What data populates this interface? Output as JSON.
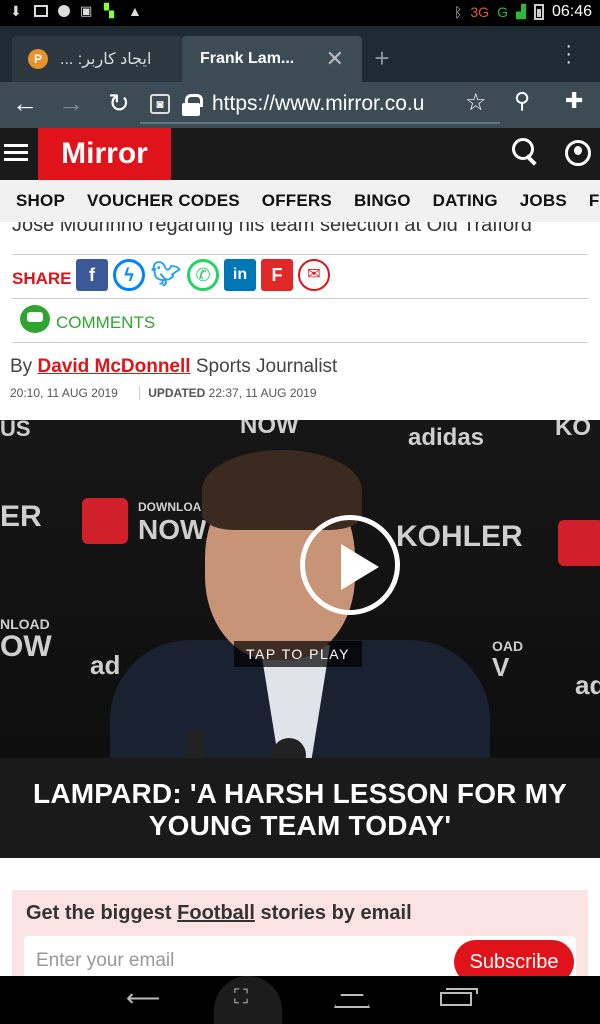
{
  "status_bar": {
    "network": "3G",
    "signal": "G",
    "time": "06:46"
  },
  "tabs": [
    {
      "title": "ایجاد کاربر: ...",
      "active": false
    },
    {
      "title": "Frank Lam...",
      "active": true
    }
  ],
  "address_bar": {
    "url": "https://www.mirror.co.u"
  },
  "site": {
    "logo": "Mirror",
    "brand_color": "#e0131a"
  },
  "nav": {
    "items": [
      "SHOP",
      "VOUCHER CODES",
      "OFFERS",
      "BINGO",
      "DATING",
      "JOBS",
      "FUNERAL"
    ]
  },
  "article": {
    "standfirst_tail": "Jose Mourinho regarding his team selection at Old Trafford",
    "share_label": "SHARE",
    "share_icons": [
      "facebook-icon",
      "messenger-icon",
      "twitter-icon",
      "whatsapp-icon",
      "linkedin-icon",
      "flipboard-icon",
      "email-icon"
    ],
    "comments_label": "COMMENTS",
    "byline_prefix": "By",
    "author": "David McDonnell",
    "author_role": "Sports Journalist",
    "published": "20:10, 11 AUG 2019",
    "updated_label": "UPDATED",
    "updated": "22:37, 11 AUG 2019"
  },
  "video": {
    "tap_to_play": "TAP TO PLAY",
    "caption": "LAMPARD: 'A HARSH LESSON FOR MY YOUNG TEAM TODAY'",
    "backdrop_text": {
      "top_left": "US",
      "top_mid": "NOW",
      "adidas": "adidas",
      "top_right": "KO",
      "left_er": "ER",
      "download": "DOWNLOAD",
      "now": "NOW",
      "kohler": "KOHLER",
      "left_bottom_small": "NLOAD",
      "left_bottom_big": "OW",
      "ad": "ad",
      "right_small": "OAD",
      "right_big": "V",
      "ad_right": "ad"
    }
  },
  "newsletter": {
    "title_prefix": "Get the biggest",
    "title_link": "Football",
    "title_suffix": "stories by email",
    "placeholder": "Enter your email",
    "button": "Subscribe"
  }
}
